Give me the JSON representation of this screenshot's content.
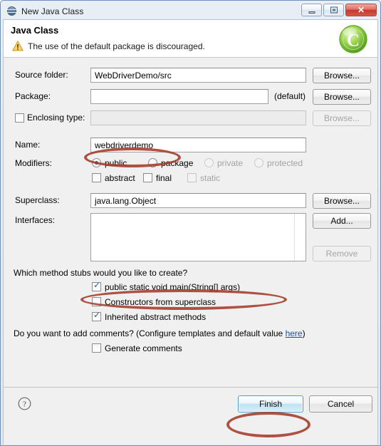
{
  "window": {
    "title": "New Java Class",
    "icon": "java-class-wizard-icon",
    "minimize_label": "Minimize",
    "maximize_label": "Maximize",
    "close_label": "Close"
  },
  "banner": {
    "title": "Java Class",
    "message": "The use of the default package is discouraged.",
    "message_icon": "warning-triangle-icon",
    "logo_icon": "java-class-green-c-icon",
    "logo_letter": "C"
  },
  "form": {
    "source_folder": {
      "label": "Source folder:",
      "value": "WebDriverDemo/src",
      "browse_label": "Browse..."
    },
    "package": {
      "label": "Package:",
      "value": "",
      "suffix": "(default)",
      "browse_label": "Browse..."
    },
    "enclosing_type": {
      "label": "Enclosing type:",
      "checked": false,
      "value": "",
      "browse_label": "Browse...",
      "disabled": true
    },
    "name": {
      "label": "Name:",
      "value": "webdriverdemo"
    },
    "modifiers": {
      "label": "Modifiers:",
      "radios": [
        {
          "label": "public",
          "selected": true,
          "disabled": false
        },
        {
          "label": "package",
          "selected": false,
          "disabled": false
        },
        {
          "label": "private",
          "selected": false,
          "disabled": true
        },
        {
          "label": "protected",
          "selected": false,
          "disabled": true
        }
      ],
      "checkboxes": [
        {
          "label": "abstract",
          "checked": false,
          "disabled": false
        },
        {
          "label": "final",
          "checked": false,
          "disabled": false
        },
        {
          "label": "static",
          "checked": false,
          "disabled": true
        }
      ]
    },
    "superclass": {
      "label": "Superclass:",
      "value": "java.lang.Object",
      "browse_label": "Browse..."
    },
    "interfaces": {
      "label": "Interfaces:",
      "items": [],
      "add_label": "Add...",
      "remove_label": "Remove",
      "remove_disabled": true
    },
    "method_stubs": {
      "question": "Which method stubs would you like to create?",
      "options": [
        {
          "label": "public static void main(String[] args)",
          "checked": true
        },
        {
          "label": "Constructors from superclass",
          "checked": false
        },
        {
          "label": "Inherited abstract methods",
          "checked": true
        }
      ]
    },
    "comments": {
      "question_prefix": "Do you want to add comments? (Configure templates and default value ",
      "link_text": "here",
      "question_suffix": ")",
      "option": {
        "label": "Generate comments",
        "checked": false
      }
    }
  },
  "footer": {
    "help_icon": "help-question-mark-icon",
    "finish_label": "Finish",
    "cancel_label": "Cancel"
  },
  "annotations": [
    {
      "name": "highlight-name-field",
      "shape": "ellipse",
      "color": "#a33b2a"
    },
    {
      "name": "highlight-main-method",
      "shape": "ellipse",
      "color": "#a33b2a"
    },
    {
      "name": "highlight-finish",
      "shape": "ellipse",
      "color": "#a33b2a"
    }
  ],
  "colors": {
    "annotation": "#a33b2a",
    "link": "#1a4fa0",
    "accent_green": "#7cc142",
    "default_button": "#b7def0"
  }
}
